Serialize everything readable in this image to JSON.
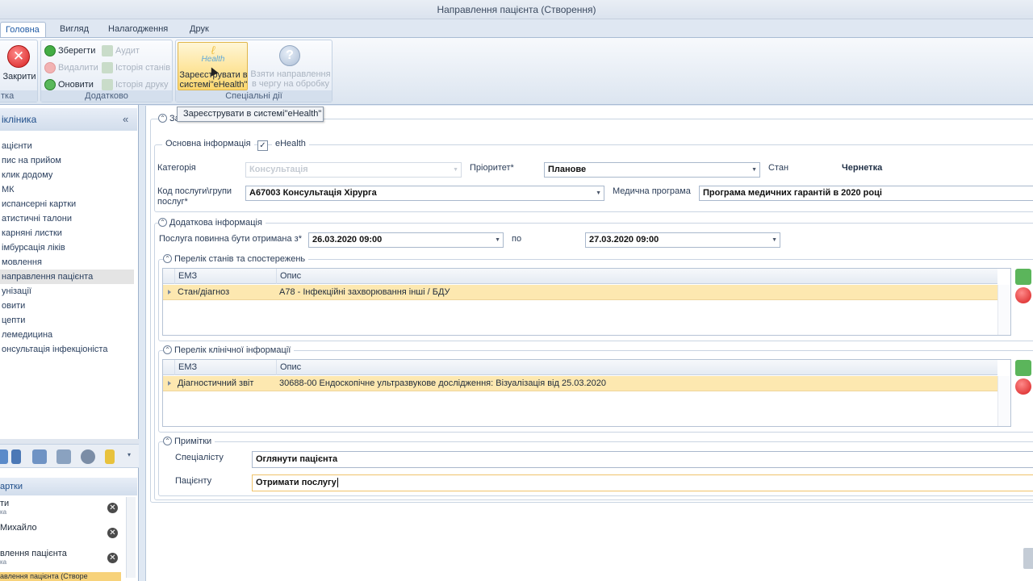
{
  "window": {
    "title": "Направлення пацієнта (Створення)"
  },
  "ribbon_tabs": [
    {
      "label": "Головна"
    },
    {
      "label": "Вигляд"
    },
    {
      "label": "Налагодження"
    },
    {
      "label": "Друк"
    }
  ],
  "ribbon": {
    "close": {
      "label": "Закрити",
      "group_caption": "тка"
    },
    "extra": {
      "save": "Зберегти",
      "delete": "Видалити",
      "refresh": "Оновити",
      "audit": "Аудит",
      "state_history": "Історія станів",
      "print_history": "Історія друку",
      "group_caption": "Додатково"
    },
    "special": {
      "register_line1": "Зареєструвати в",
      "register_line2": "системі\"eHealth\"",
      "take_line1": "Взяти направлення",
      "take_line2": "в чергу на обробку",
      "ehealth_logo": "Health",
      "group_caption": "Спеціальні дії"
    },
    "tooltip": "Зареєструвати в системі\"eHealth\""
  },
  "nav": {
    "header": "ікліника",
    "collapse_icon": "«",
    "items": [
      {
        "label": "ацієнти"
      },
      {
        "label": "пис на прийом"
      },
      {
        "label": "клик додому"
      },
      {
        "label": "МК"
      },
      {
        "label": "испансерні картки"
      },
      {
        "label": "атистичні талони"
      },
      {
        "label": "карняні листки"
      },
      {
        "label": "імбурсація ліків"
      },
      {
        "label": "мовлення"
      },
      {
        "label": "направлення пацієнта"
      },
      {
        "label": "унізації"
      },
      {
        "label": "овити"
      },
      {
        "label": "цепти"
      },
      {
        "label": "лемедицина"
      },
      {
        "label": "онсультація інфекціоніста"
      }
    ],
    "cards_header": "артки",
    "cards": [
      {
        "title": "ти",
        "sub": "ка"
      },
      {
        "title": "Михайло",
        "sub": ""
      },
      {
        "title": "влення пацієнта",
        "sub": "ка"
      },
      {
        "title": "авлення пацієнта (Створе",
        "sub": ""
      }
    ]
  },
  "form": {
    "section_main": "За",
    "basic": {
      "title": "Основна інформація",
      "ehealth_label": "eHealth",
      "ehealth_checked": true
    },
    "category": {
      "label": "Категорія",
      "value": "Консультація"
    },
    "priority": {
      "label": "Пріоритет*",
      "value": "Планове"
    },
    "state": {
      "label": "Стан",
      "value": "Чернетка"
    },
    "service_code": {
      "label_line1": "Код послуги\\групи",
      "label_line2": "послуг*",
      "value": "А67003 Консультація Хірурга"
    },
    "program": {
      "label": "Медична програма",
      "value": "Програма медичних гарантій в 2020 році"
    },
    "additional": {
      "title": "Додаткова інформація",
      "service_from_label": "Послуга повинна бути отримана з*",
      "service_from_value": "26.03.2020 09:00",
      "to_label": "по",
      "service_to_value": "27.03.2020 09:00"
    },
    "conditions": {
      "title": "Перелік станів та спостережень",
      "columns": [
        "ЕМЗ",
        "Опис"
      ],
      "rows": [
        {
          "emz": "Стан/діагноз",
          "desc": "A78 - Інфекційні захворювання інші / БДУ"
        }
      ]
    },
    "clinical": {
      "title": "Перелік клінічної інформації",
      "columns": [
        "ЕМЗ",
        "Опис"
      ],
      "rows": [
        {
          "emz": "Діагностичний звіт",
          "desc": "30688-00 Ендоскопічне ультразвукове дослідження: Візуалізація від 25.03.2020"
        }
      ]
    },
    "notes": {
      "title": "Примітки",
      "specialist_label": "Спеціалісту",
      "specialist_value": "Оглянути пацієнта",
      "patient_label": "Пацієнту",
      "patient_value": "Отримати послугу"
    }
  },
  "colors": {
    "accent": "#1f5aa5",
    "row_highlight": "#fde8b0",
    "close_red": "#e03a3a",
    "ok_green": "#3aa83a"
  }
}
